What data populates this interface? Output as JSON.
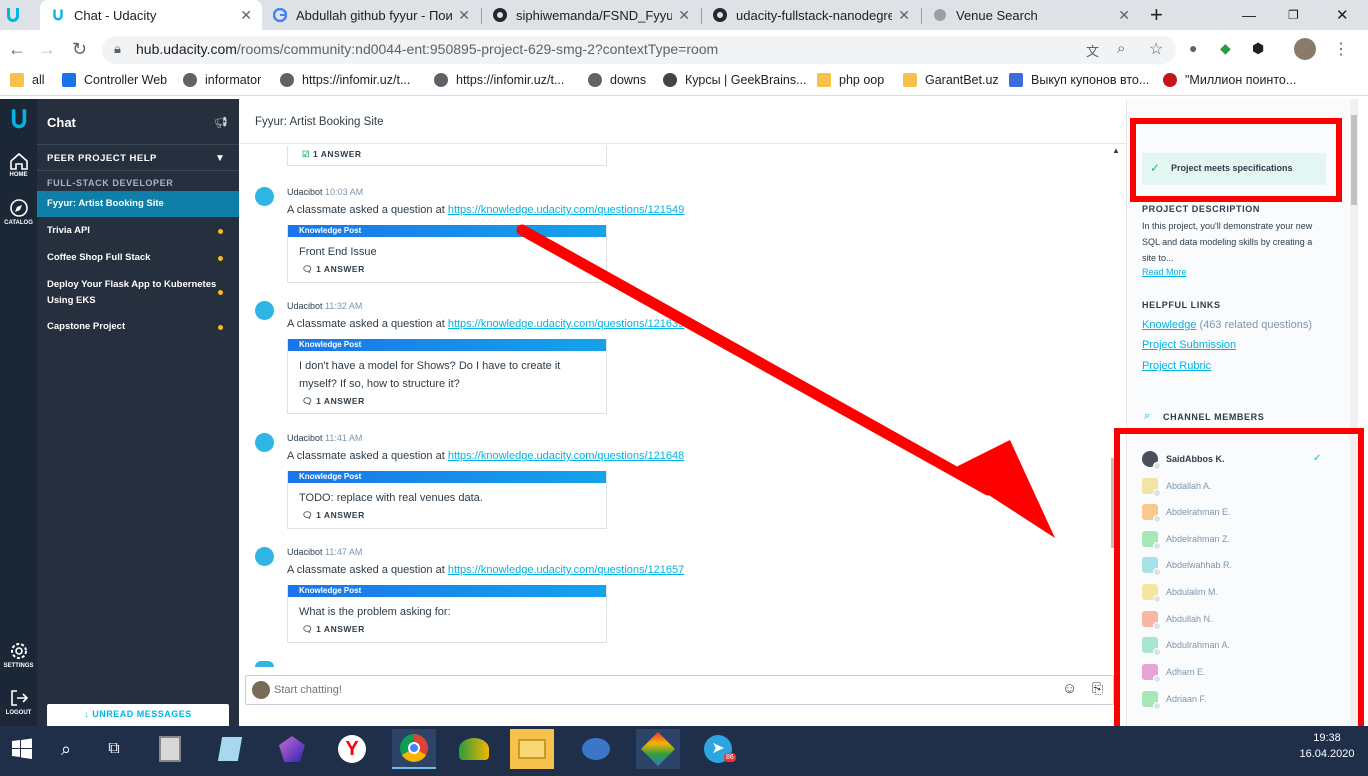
{
  "browser": {
    "tabs": [
      {
        "title": "Chat - Udacity",
        "active": true,
        "icon": "udacity-icon"
      },
      {
        "title": "Abdullah github fyyur - Поис",
        "active": false,
        "icon": "google-icon"
      },
      {
        "title": "siphiwemanda/FSND_FyyurAp",
        "active": false,
        "icon": "github-icon"
      },
      {
        "title": "udacity-fullstack-nanodegree",
        "active": false,
        "icon": "github-icon"
      },
      {
        "title": "Venue Search",
        "active": false,
        "icon": "globe-icon"
      }
    ],
    "url_domain": "hub.udacity.com",
    "url_path": "/rooms/community:nd0044-ent:950895-project-629-smg-2?contextType=room",
    "bookmarks": [
      {
        "label": "all",
        "color": "#f6c24b"
      },
      {
        "label": "Controller Web",
        "color": "#1a73e8"
      },
      {
        "label": "informator",
        "color": "#5f6368"
      },
      {
        "label": "https://infomir.uz/t...",
        "color": "#5f6368"
      },
      {
        "label": "https://infomir.uz/t...",
        "color": "#5f6368"
      },
      {
        "label": "downs",
        "color": "#5f6368"
      },
      {
        "label": "Курсы | GeekBrains...",
        "color": "#444"
      },
      {
        "label": "php ооp",
        "color": "#f6c24b"
      },
      {
        "label": "GarantBet.uz",
        "color": "#f6c24b"
      },
      {
        "label": "Выкуп купонов вто...",
        "color": "#3b6bdc"
      },
      {
        "label": "\"Миллион поинто...",
        "color": "#c4151c"
      }
    ]
  },
  "rail": {
    "home": "HOME",
    "catalog": "CATALOG",
    "settings": "SETTINGS",
    "logout": "LOGOUT"
  },
  "sidebar": {
    "title": "Chat",
    "section": "PEER PROJECT HELP",
    "subsection": "FULL-STACK DEVELOPER",
    "items": [
      {
        "label": "Fyyur: Artist Booking Site",
        "active": true,
        "unread": false
      },
      {
        "label": "Trivia API",
        "active": false,
        "unread": true
      },
      {
        "label": "Coffee Shop Full Stack",
        "active": false,
        "unread": true
      },
      {
        "label": "Deploy Your Flask App to Kubernetes Using EKS",
        "active": false,
        "unread": true
      },
      {
        "label": "Capstone Project",
        "active": false,
        "unread": true
      }
    ],
    "unread_button": "UNREAD MESSAGES"
  },
  "main": {
    "title": "Fyyur: Artist Booking Site",
    "top_answer": "1 ANSWER",
    "messages": [
      {
        "author": "Udacibot",
        "time": "10:03 AM",
        "text": "A classmate asked a question at ",
        "link": "https://knowledge.udacity.com/questions/121549",
        "card_label": "Knowledge Post",
        "question": "Front End Issue",
        "answers": "1 ANSWER"
      },
      {
        "author": "Udacibot",
        "time": "11:32 AM",
        "text": "A classmate asked a question at ",
        "link": "https://knowledge.udacity.com/questions/121639",
        "card_label": "Knowledge Post",
        "question": "I don't have a model for Shows? Do I have to create it myself? If so, how to structure it?",
        "answers": "1 ANSWER"
      },
      {
        "author": "Udacibot",
        "time": "11:41 AM",
        "text": "A classmate asked a question at ",
        "link": "https://knowledge.udacity.com/questions/121648",
        "card_label": "Knowledge Post",
        "question": "TODO: replace with real venues data.",
        "answers": "1 ANSWER"
      },
      {
        "author": "Udacibot",
        "time": "11:47 AM",
        "text": "A classmate asked a question at ",
        "link": "https://knowledge.udacity.com/questions/121657",
        "card_label": "Knowledge Post",
        "question": "What is the problem asking for:",
        "answers": "1 ANSWER"
      }
    ],
    "chat_placeholder": "Start chatting!"
  },
  "rightpanel": {
    "status": "Project meets specifications",
    "description_heading": "PROJECT DESCRIPTION",
    "description": "In this project, you'll demonstrate your new SQL and data modeling skills by creating a site to...",
    "read_more": "Read More",
    "links_heading": "HELPFUL LINKS",
    "knowledge_link": "Knowledge",
    "knowledge_count": " (463 related questions)",
    "submission_link": "Project Submission",
    "rubric_link": "Project Rubric",
    "members_heading": "CHANNEL MEMBERS",
    "members": [
      {
        "name": "SaidAbbos K.",
        "color": "#4a4f5a",
        "self": true
      },
      {
        "name": "Abdallah A.",
        "color": "#f4e4a2"
      },
      {
        "name": "Abdelrahman E.",
        "color": "#f7c98c"
      },
      {
        "name": "Abdelrahman Z.",
        "color": "#a8e6b8"
      },
      {
        "name": "Abdelwahhab R.",
        "color": "#a6e3e6"
      },
      {
        "name": "Abdulalim M.",
        "color": "#f4e4a2"
      },
      {
        "name": "Abdullah N.",
        "color": "#f7b7a3"
      },
      {
        "name": "Abdulrahman A.",
        "color": "#a8e6cf"
      },
      {
        "name": "Adham E.",
        "color": "#e9a2d6"
      },
      {
        "name": "Adriaan F.",
        "color": "#a8e6b8"
      }
    ]
  },
  "taskbar": {
    "time": "19:38",
    "date": "16.04.2020",
    "telegram_badge": "86"
  },
  "annotation_color": "#ff0000"
}
